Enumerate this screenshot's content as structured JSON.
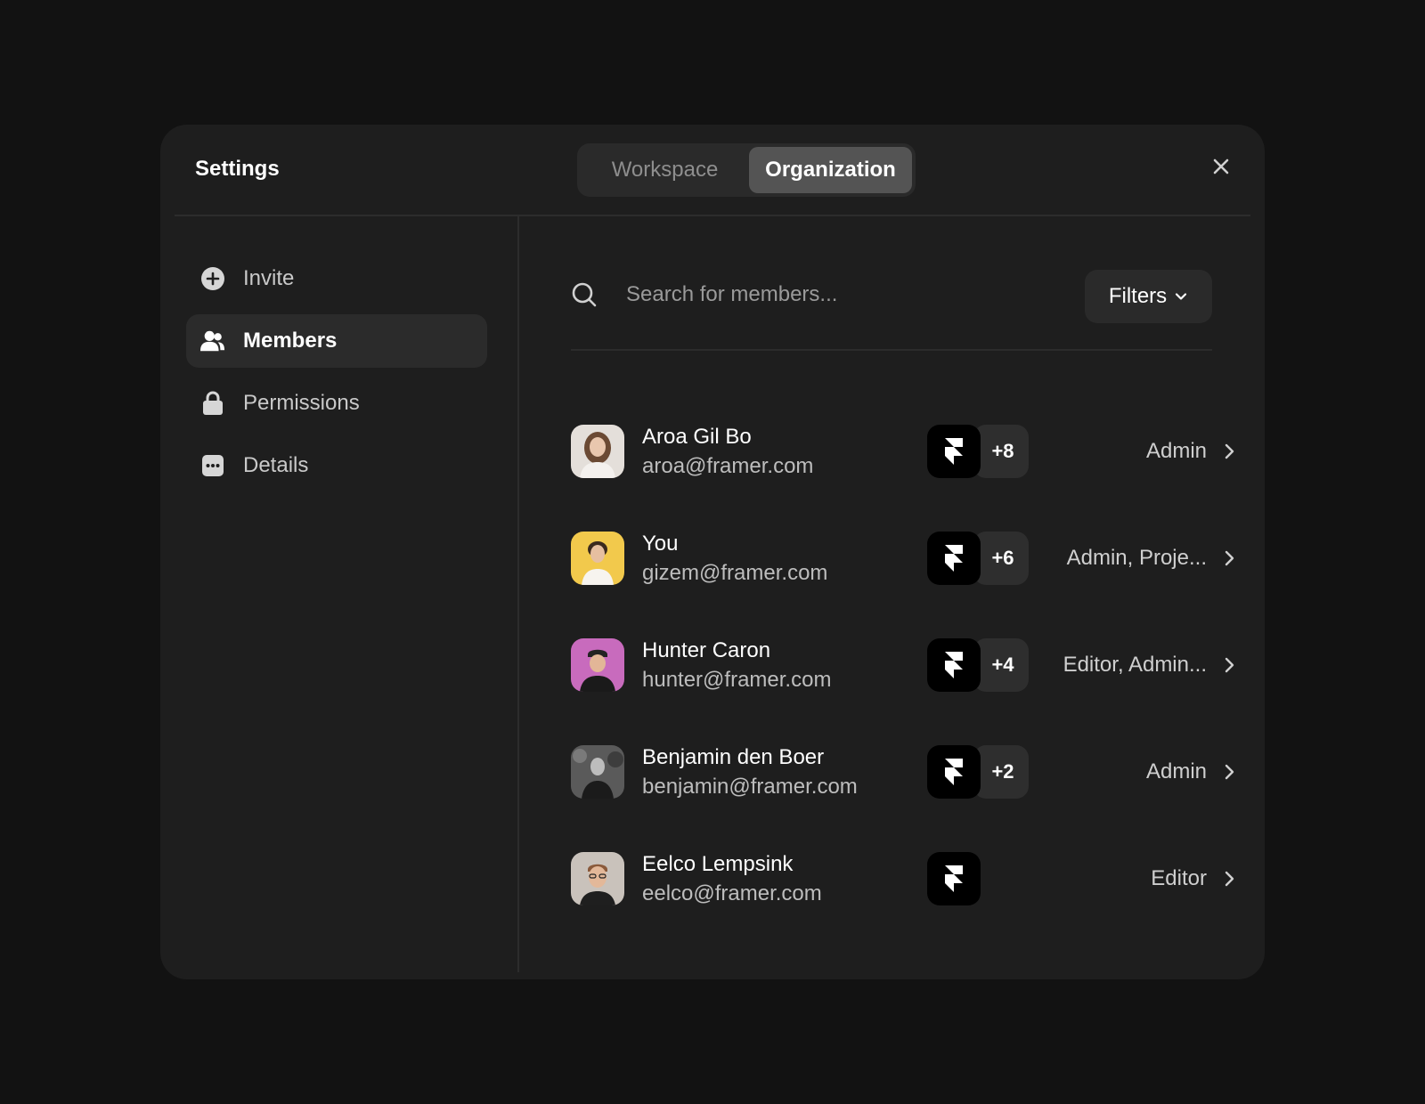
{
  "header": {
    "title": "Settings",
    "tabs": [
      {
        "label": "Workspace",
        "selected": false
      },
      {
        "label": "Organization",
        "selected": true
      }
    ]
  },
  "sidebar": {
    "items": [
      {
        "label": "Invite",
        "icon": "plus-circle-icon",
        "active": false
      },
      {
        "label": "Members",
        "icon": "users-icon",
        "active": true
      },
      {
        "label": "Permissions",
        "icon": "lock-icon",
        "active": false
      },
      {
        "label": "Details",
        "icon": "more-square-icon",
        "active": false
      }
    ]
  },
  "search": {
    "placeholder": "Search for members...",
    "value": "",
    "filters_label": "Filters"
  },
  "members": [
    {
      "name": "Aroa Gil Bo",
      "email": "aroa@framer.com",
      "extra_count": "+8",
      "role": "Admin",
      "avatar_bg": "#d8d2cc"
    },
    {
      "name": "You",
      "email": "gizem@framer.com",
      "extra_count": "+6",
      "role": "Admin, Proje...",
      "avatar_bg": "#f2c94c"
    },
    {
      "name": "Hunter Caron",
      "email": "hunter@framer.com",
      "extra_count": "+4",
      "role": "Editor, Admin...",
      "avatar_bg": "#c86bbd"
    },
    {
      "name": "Benjamin den Boer",
      "email": "benjamin@framer.com",
      "extra_count": "+2",
      "role": "Admin",
      "avatar_bg": "#5a5a5a"
    },
    {
      "name": "Eelco Lempsink",
      "email": "eelco@framer.com",
      "extra_count": "",
      "role": "Editor",
      "avatar_bg": "#c9c2bb"
    }
  ],
  "colors": {
    "background": "#121212",
    "modal": "#1e1e1e",
    "selected_tab": "#545454",
    "active_nav": "#2b2b2b"
  }
}
